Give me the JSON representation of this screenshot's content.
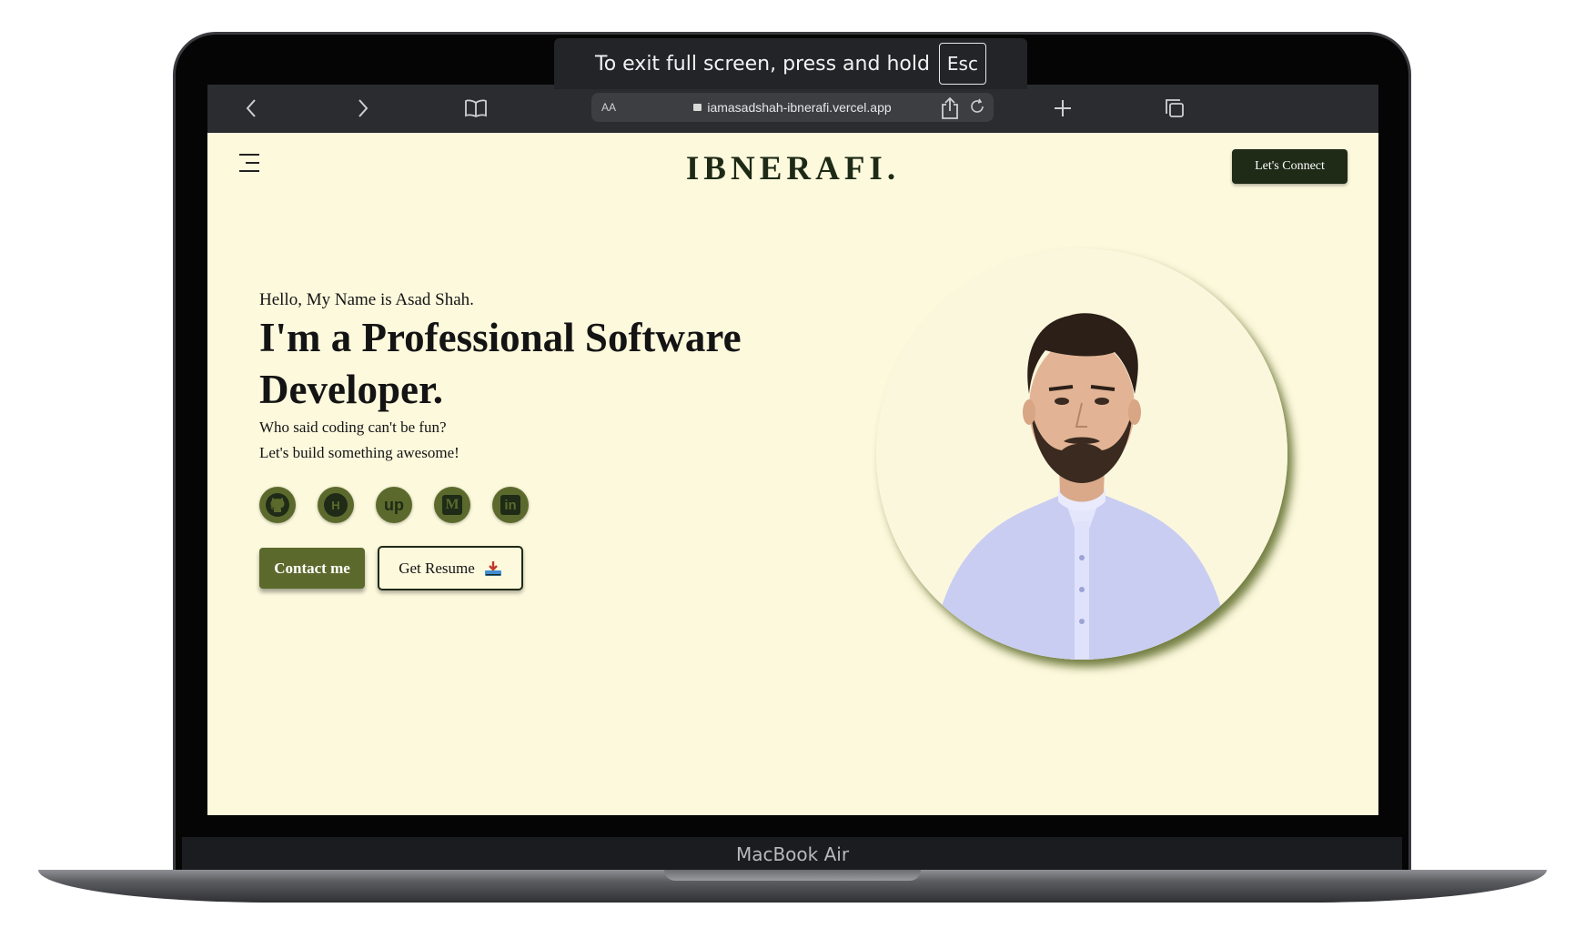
{
  "device": {
    "label": "MacBook Air"
  },
  "fullscreen_toast": {
    "message": "To exit full screen, press and hold",
    "key": "Esc"
  },
  "browser": {
    "reader_label": "AA",
    "url": "iamasadshah-ibnerafi.vercel.app",
    "icons": [
      "back-icon",
      "forward-icon",
      "bookmarks-icon",
      "share-icon",
      "new-tab-icon",
      "tabs-icon",
      "reload-icon"
    ]
  },
  "site": {
    "logo": "IBNERAFI.",
    "connect_button": "Let's Connect",
    "hero": {
      "greeting": "Hello, My Name is Asad Shah.",
      "headline": "I'm a Professional Software Developer.",
      "tagline_1": "Who said coding can't be fun?",
      "tagline_2": "Let's build something awesome!"
    },
    "socials": [
      {
        "name": "github",
        "glyph": ""
      },
      {
        "name": "hashnode",
        "glyph": "H"
      },
      {
        "name": "upwork",
        "glyph": "up"
      },
      {
        "name": "medium",
        "glyph": "M"
      },
      {
        "name": "linkedin",
        "glyph": "in"
      }
    ],
    "buttons": {
      "contact": "Contact me",
      "resume": "Get Resume"
    },
    "colors": {
      "background": "#fdf9dd",
      "primary": "#5b6a2c",
      "dark": "#1f2a17"
    }
  }
}
